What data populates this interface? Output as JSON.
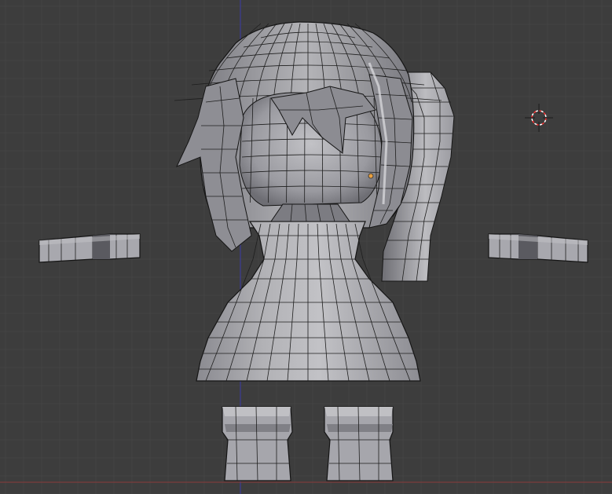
{
  "viewport": {
    "background_color": "#3d3d3d",
    "grid_color": "#444444",
    "grid_major_color": "#4a4a4a",
    "y_axis_color": "#3a3aa8",
    "x_axis_color": "#8a3a3a",
    "mesh_color": "#a8a8ac",
    "wire_color": "#1e1e1e",
    "object_origin_color": "#e8a040",
    "cursor_colors": [
      "#ff3030",
      "#ffffff",
      "#1a1a1a"
    ]
  },
  "scene": {
    "mesh_parts": [
      "head",
      "ponytail",
      "hair-strands",
      "body-dress",
      "left-arm",
      "right-arm",
      "left-leg",
      "right-leg"
    ],
    "icons": [
      "3d-cursor-icon",
      "object-origin-icon"
    ]
  }
}
